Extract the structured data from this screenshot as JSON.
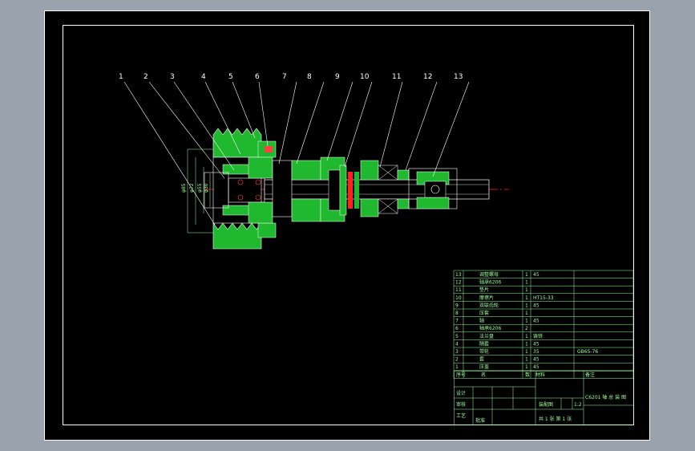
{
  "drawing": {
    "balloons": [
      "1",
      "2",
      "3",
      "4",
      "5",
      "6",
      "7",
      "8",
      "9",
      "10",
      "11",
      "12",
      "13"
    ],
    "dimensions": [
      "φ85",
      "φ72",
      "φ55",
      "φ30"
    ]
  },
  "bom": {
    "rows": [
      {
        "no": "13",
        "name": "调整螺母",
        "qty": "1",
        "material": "45",
        "std": ""
      },
      {
        "no": "12",
        "name": "轴承6206",
        "qty": "1",
        "material": "",
        "std": ""
      },
      {
        "no": "11",
        "name": "垫片",
        "qty": "1",
        "material": "",
        "std": ""
      },
      {
        "no": "10",
        "name": "摩擦片",
        "qty": "1",
        "material": "HT15-33",
        "std": ""
      },
      {
        "no": "9",
        "name": "双联齿轮",
        "qty": "1",
        "material": "45",
        "std": ""
      },
      {
        "no": "8",
        "name": "压套",
        "qty": "1",
        "material": "",
        "std": ""
      },
      {
        "no": "7",
        "name": "轴",
        "qty": "1",
        "material": "45",
        "std": ""
      },
      {
        "no": "6",
        "name": "轴承6206",
        "qty": "2",
        "material": "",
        "std": ""
      },
      {
        "no": "5",
        "name": "法兰盘",
        "qty": "1",
        "material": "铸铁",
        "std": ""
      },
      {
        "no": "4",
        "name": "隔套",
        "qty": "1",
        "material": "45",
        "std": ""
      },
      {
        "no": "3",
        "name": "带轮",
        "qty": "1",
        "material": "35",
        "std": "GB65-76"
      },
      {
        "no": "2",
        "name": "套",
        "qty": "1",
        "material": "45",
        "std": ""
      },
      {
        "no": "1",
        "name": "压盖",
        "qty": "1",
        "material": "45",
        "std": ""
      }
    ],
    "header": {
      "no": "序号",
      "name": "名",
      "qty": "数",
      "material": "材料",
      "remark": "备注"
    }
  },
  "title_block": {
    "title": "C6201 轴 总 装 图",
    "drawing_no": "装配图",
    "scale": "1:2",
    "sheet": "共 1 张 第 1 张",
    "designer": "设计",
    "checker": "审核",
    "approver": "工艺",
    "date": "批准"
  },
  "colors": {
    "line": "#ffffff",
    "section": "#22c532",
    "dim": "#9dff9d",
    "center": "#ff2020",
    "frame": "#ffffff",
    "bg": "#000000"
  }
}
